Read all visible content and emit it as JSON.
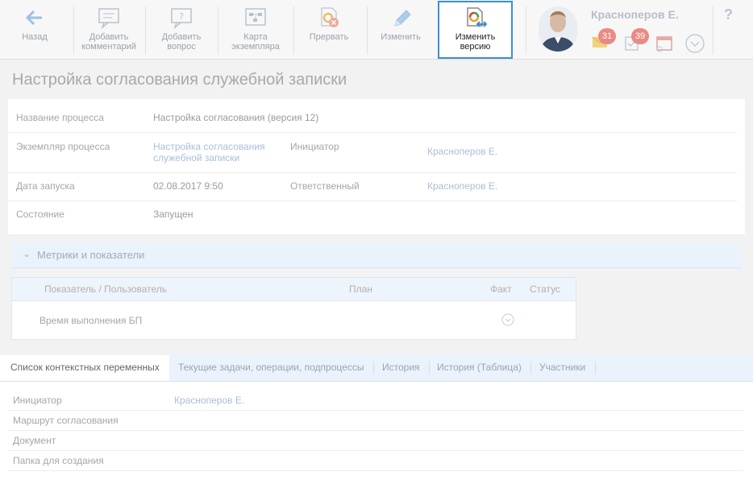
{
  "toolbar": {
    "back": "Назад",
    "add_comment": [
      "Добавить",
      "комментарий"
    ],
    "add_question": [
      "Добавить",
      "вопрос"
    ],
    "instance_map": [
      "Карта",
      "экземпляра"
    ],
    "abort": "Прервать",
    "edit": "Изменить",
    "change_version": [
      "Изменить",
      "версию"
    ]
  },
  "user": {
    "name": "Красноперов Е.",
    "mail_count": "31",
    "tasks_count": "39"
  },
  "help": "?",
  "page_title": "Настройка согласования служебной записки",
  "info": {
    "process_name_label": "Название процесса",
    "process_name_value": "Настройка согласования (версия 12)",
    "instance_label": "Экземпляр процесса",
    "instance_value": [
      "Настройка согласования",
      "служебной записки"
    ],
    "initiator_label": "Инициатор",
    "initiator_value": "Красноперов Е.",
    "start_date_label": "Дата запуска",
    "start_date_value": "02.08.2017 9:50",
    "responsible_label": "Ответственный",
    "responsible_value": "Красноперов Е.",
    "state_label": "Состояние",
    "state_value": "Запущен"
  },
  "metrics": {
    "title": "Метрики и показатели",
    "columns": [
      "Показатель / Пользователь",
      "План",
      "Факт",
      "Статус"
    ],
    "rows": [
      {
        "name": "Время выполнения БП",
        "plan": "",
        "fact": "",
        "status": ""
      }
    ]
  },
  "tabs": [
    "Список контекстных переменных",
    "Текущие задачи, операции, подпроцессы",
    "История",
    "История (Таблица)",
    "Участники"
  ],
  "context_vars": [
    {
      "key": "Инициатор",
      "value": "Красноперов Е."
    },
    {
      "key": "Маршрут согласования",
      "value": ""
    },
    {
      "key": "Документ",
      "value": ""
    },
    {
      "key": "Папка для создания",
      "value": ""
    }
  ],
  "colors": {
    "accent": "#3c8fd1",
    "badge": "#e98a85",
    "link": "#a9bedb"
  }
}
